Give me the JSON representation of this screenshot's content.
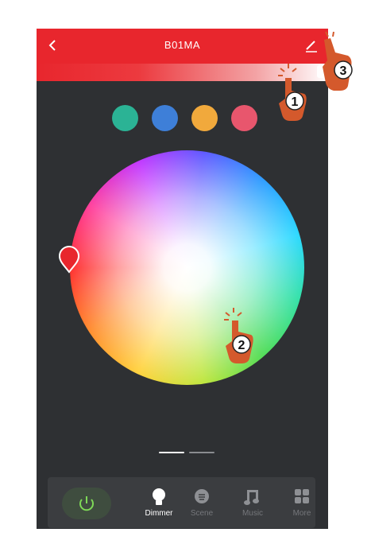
{
  "header": {
    "title": "B01MA",
    "back_icon": "chevron-left-icon",
    "edit_icon": "edit-pencil-icon"
  },
  "brightness": {
    "level": 0.95,
    "colors": [
      "#e8262d",
      "#ffffff"
    ]
  },
  "presets": [
    {
      "name": "green",
      "color": "#2bb395"
    },
    {
      "name": "blue",
      "color": "#3e7fd8"
    },
    {
      "name": "orange",
      "color": "#f1a93c"
    },
    {
      "name": "red",
      "color": "#e8566d"
    }
  ],
  "color_wheel": {
    "selected_color": "#e8262d",
    "picker_icon": "location-pin-icon"
  },
  "pager": {
    "pages": 2,
    "active": 1
  },
  "tabbar": {
    "power_icon": "power-icon",
    "tabs": [
      {
        "label": "Dimmer",
        "icon": "bulb-icon",
        "active": true
      },
      {
        "label": "Scene",
        "icon": "scene-icon",
        "active": false
      },
      {
        "label": "Music",
        "icon": "music-note-icon",
        "active": false
      },
      {
        "label": "More",
        "icon": "grid-icon",
        "active": false
      }
    ]
  },
  "annotations": [
    {
      "step": "1",
      "icon": "tap-hand-icon"
    },
    {
      "step": "2",
      "icon": "tap-hand-icon"
    },
    {
      "step": "3",
      "icon": "tap-hand-icon"
    }
  ],
  "colors": {
    "accent": "#e8262d",
    "background": "#2e3033",
    "tabbar": "#3b3d40",
    "power_active": "#7ed957",
    "hand": "#d4592c"
  }
}
